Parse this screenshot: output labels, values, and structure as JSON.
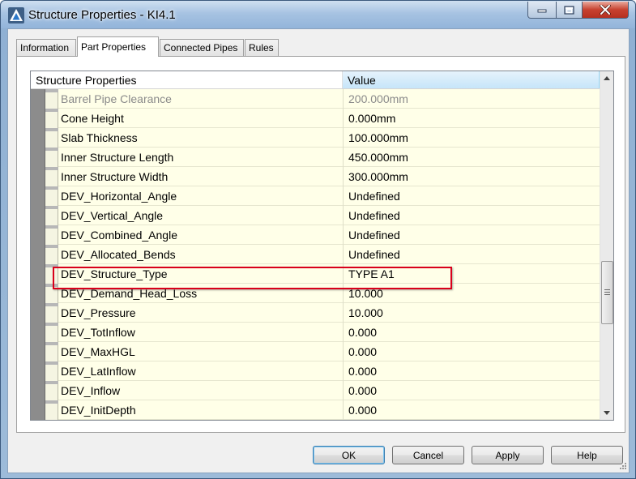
{
  "window": {
    "title": "Structure Properties - KI4.1",
    "title_icon": "autocad-civil-icon",
    "controls": {
      "minimize": "minimize-icon",
      "maximize": "maximize-icon",
      "close": "close-icon"
    }
  },
  "tabs": [
    {
      "label": "Information",
      "active": false
    },
    {
      "label": "Part Properties",
      "active": true
    },
    {
      "label": "Connected Pipes",
      "active": false
    },
    {
      "label": "Rules",
      "active": false
    }
  ],
  "grid": {
    "columns": {
      "name": "Structure Properties",
      "value": "Value"
    },
    "rows": [
      {
        "name": "Barrel Pipe Clearance",
        "value": "200.000mm",
        "disabled": true
      },
      {
        "name": "Cone Height",
        "value": "0.000mm"
      },
      {
        "name": "Slab Thickness",
        "value": "100.000mm"
      },
      {
        "name": "Inner Structure Length",
        "value": "450.000mm"
      },
      {
        "name": "Inner Structure Width",
        "value": "300.000mm"
      },
      {
        "name": "DEV_Horizontal_Angle",
        "value": "Undefined"
      },
      {
        "name": "DEV_Vertical_Angle",
        "value": "Undefined"
      },
      {
        "name": "DEV_Combined_Angle",
        "value": "Undefined"
      },
      {
        "name": "DEV_Allocated_Bends",
        "value": "Undefined"
      },
      {
        "name": "DEV_Structure_Type",
        "value": "TYPE A1"
      },
      {
        "name": "DEV_Demand_Head_Loss",
        "value": "10.000"
      },
      {
        "name": "DEV_Pressure",
        "value": "10.000"
      },
      {
        "name": "DEV_TotInflow",
        "value": "0.000"
      },
      {
        "name": "DEV_MaxHGL",
        "value": "0.000"
      },
      {
        "name": "DEV_LatInflow",
        "value": "0.000"
      },
      {
        "name": "DEV_Inflow",
        "value": "0.000"
      },
      {
        "name": "DEV_InitDepth",
        "value": "0.000"
      }
    ],
    "highlighted_row": "DEV_Structure_Type",
    "highlight_color": "#d9001b"
  },
  "buttons": {
    "ok": "OK",
    "cancel": "Cancel",
    "apply": "Apply",
    "help": "Help"
  },
  "colors": {
    "row_background": "#ffffe8",
    "value_header": "#c6e5f9",
    "close_button": "#c7412f"
  }
}
